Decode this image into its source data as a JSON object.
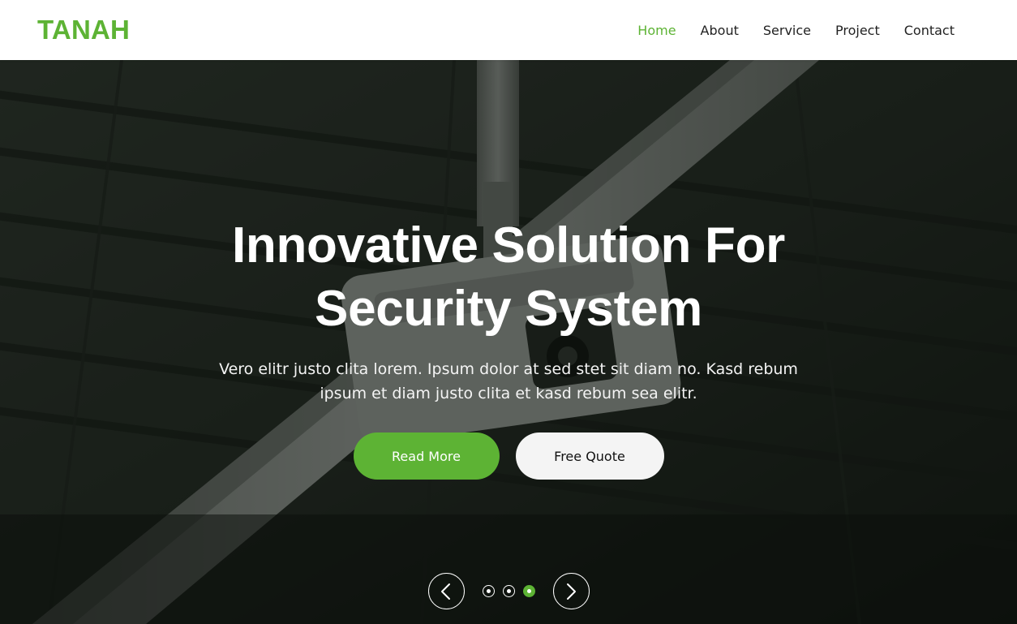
{
  "brand": {
    "name": "TANAH",
    "color": "#5db334"
  },
  "nav": {
    "items": [
      {
        "label": "Home",
        "active": true
      },
      {
        "label": "About",
        "active": false
      },
      {
        "label": "Service",
        "active": false
      },
      {
        "label": "Project",
        "active": false
      },
      {
        "label": "Contact",
        "active": false
      }
    ]
  },
  "hero": {
    "title": "Innovative Solution For Security System",
    "text": "Vero elitr justo clita lorem. Ipsum dolor at sed stet sit diam no. Kasd rebum ipsum et diam justo clita et kasd rebum sea elitr.",
    "primary_button": "Read More",
    "secondary_button": "Free Quote",
    "background_image": "security-camera-photo"
  },
  "carousel": {
    "prev_icon": "chevron-left-icon",
    "next_icon": "chevron-right-icon",
    "slide_count": 3,
    "active_slide": 3
  },
  "colors": {
    "accent": "#5db334",
    "light_button": "#f4f4f4",
    "overlay": "#0a0e0a"
  }
}
